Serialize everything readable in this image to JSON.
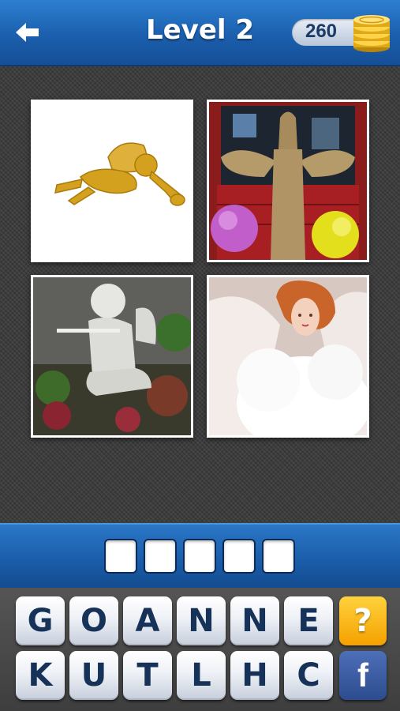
{
  "header": {
    "back_icon": "back-arrow-icon",
    "title": "Level 2",
    "coins": "260",
    "coins_icon": "gold-coins-icon"
  },
  "pictures": [
    {
      "subject": "golden-glitter-cherub-ornament"
    },
    {
      "subject": "straw-angel-figure-with-flowers"
    },
    {
      "subject": "stone-cherub-statue-playing-flute"
    },
    {
      "subject": "white-fluffy-angel-doll"
    }
  ],
  "answer": {
    "slots": [
      "",
      "",
      "",
      "",
      ""
    ]
  },
  "keyboard": {
    "row1": [
      "G",
      "O",
      "A",
      "N",
      "N",
      "E"
    ],
    "row2": [
      "K",
      "U",
      "T",
      "L",
      "H",
      "C"
    ],
    "hint_label": "?",
    "facebook_label": "f"
  },
  "colors": {
    "header_blue": "#1b5fae",
    "hint_orange": "#f5a100",
    "facebook_blue": "#2d4c8f",
    "key_text": "#163258"
  }
}
